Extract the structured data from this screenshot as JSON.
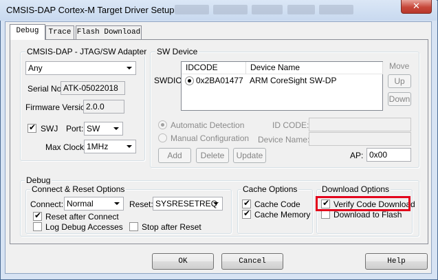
{
  "window": {
    "title": "CMSIS-DAP Cortex-M Target Driver Setup",
    "close_symbol": "✕"
  },
  "tabs": [
    {
      "label": "Debug",
      "active": true
    },
    {
      "label": "Trace",
      "active": false
    },
    {
      "label": "Flash Download",
      "active": false
    }
  ],
  "adapter": {
    "group_label": "CMSIS-DAP - JTAG/SW Adapter",
    "selected": "Any",
    "serial_label": "Serial No:",
    "serial_value": "ATK-05022018",
    "firmware_label": "Firmware Version:",
    "firmware_value": "2.0.0",
    "swj_label": "SWJ",
    "swj_checked": true,
    "port_label": "Port:",
    "port_value": "SW",
    "clock_label": "Max Clock:",
    "clock_value": "1MHz"
  },
  "sw_device": {
    "group_label": "SW Device",
    "row_label": "SWDIO",
    "columns": [
      "IDCODE",
      "Device Name"
    ],
    "rows": [
      {
        "idcode": "0x2BA01477",
        "device_name": "ARM CoreSight SW-DP"
      }
    ],
    "move_label": "Move",
    "up_label": "Up",
    "down_label": "Down",
    "auto_detect_label": "Automatic Detection",
    "manual_config_label": "Manual Configuration",
    "id_code_label": "ID CODE:",
    "device_name_label": "Device Name:",
    "add_label": "Add",
    "delete_label": "Delete",
    "update_label": "Update",
    "ap_label": "AP:",
    "ap_value": "0x00"
  },
  "debug": {
    "group_label": "Debug",
    "connect_reset": {
      "group_label": "Connect & Reset Options",
      "connect_label": "Connect:",
      "connect_value": "Normal",
      "reset_label": "Reset:",
      "reset_value": "SYSRESETREQ",
      "reset_after_connect_label": "Reset after Connect",
      "reset_after_connect_checked": true,
      "log_debug_label": "Log Debug Accesses",
      "log_debug_checked": false,
      "stop_after_reset_label": "Stop after Reset",
      "stop_after_reset_checked": false
    },
    "cache": {
      "group_label": "Cache Options",
      "cache_code_label": "Cache Code",
      "cache_code_checked": true,
      "cache_memory_label": "Cache Memory",
      "cache_memory_checked": true
    },
    "download": {
      "group_label": "Download Options",
      "verify_label": "Verify Code Download",
      "verify_checked": true,
      "download_to_flash_label": "Download to Flash",
      "download_to_flash_checked": false
    }
  },
  "footer": {
    "ok_label": "OK",
    "cancel_label": "Cancel",
    "help_label": "Help"
  },
  "colors": {
    "highlight_box": "#e3001b",
    "close_button": "#c7473a"
  },
  "check_glyph": "✔"
}
